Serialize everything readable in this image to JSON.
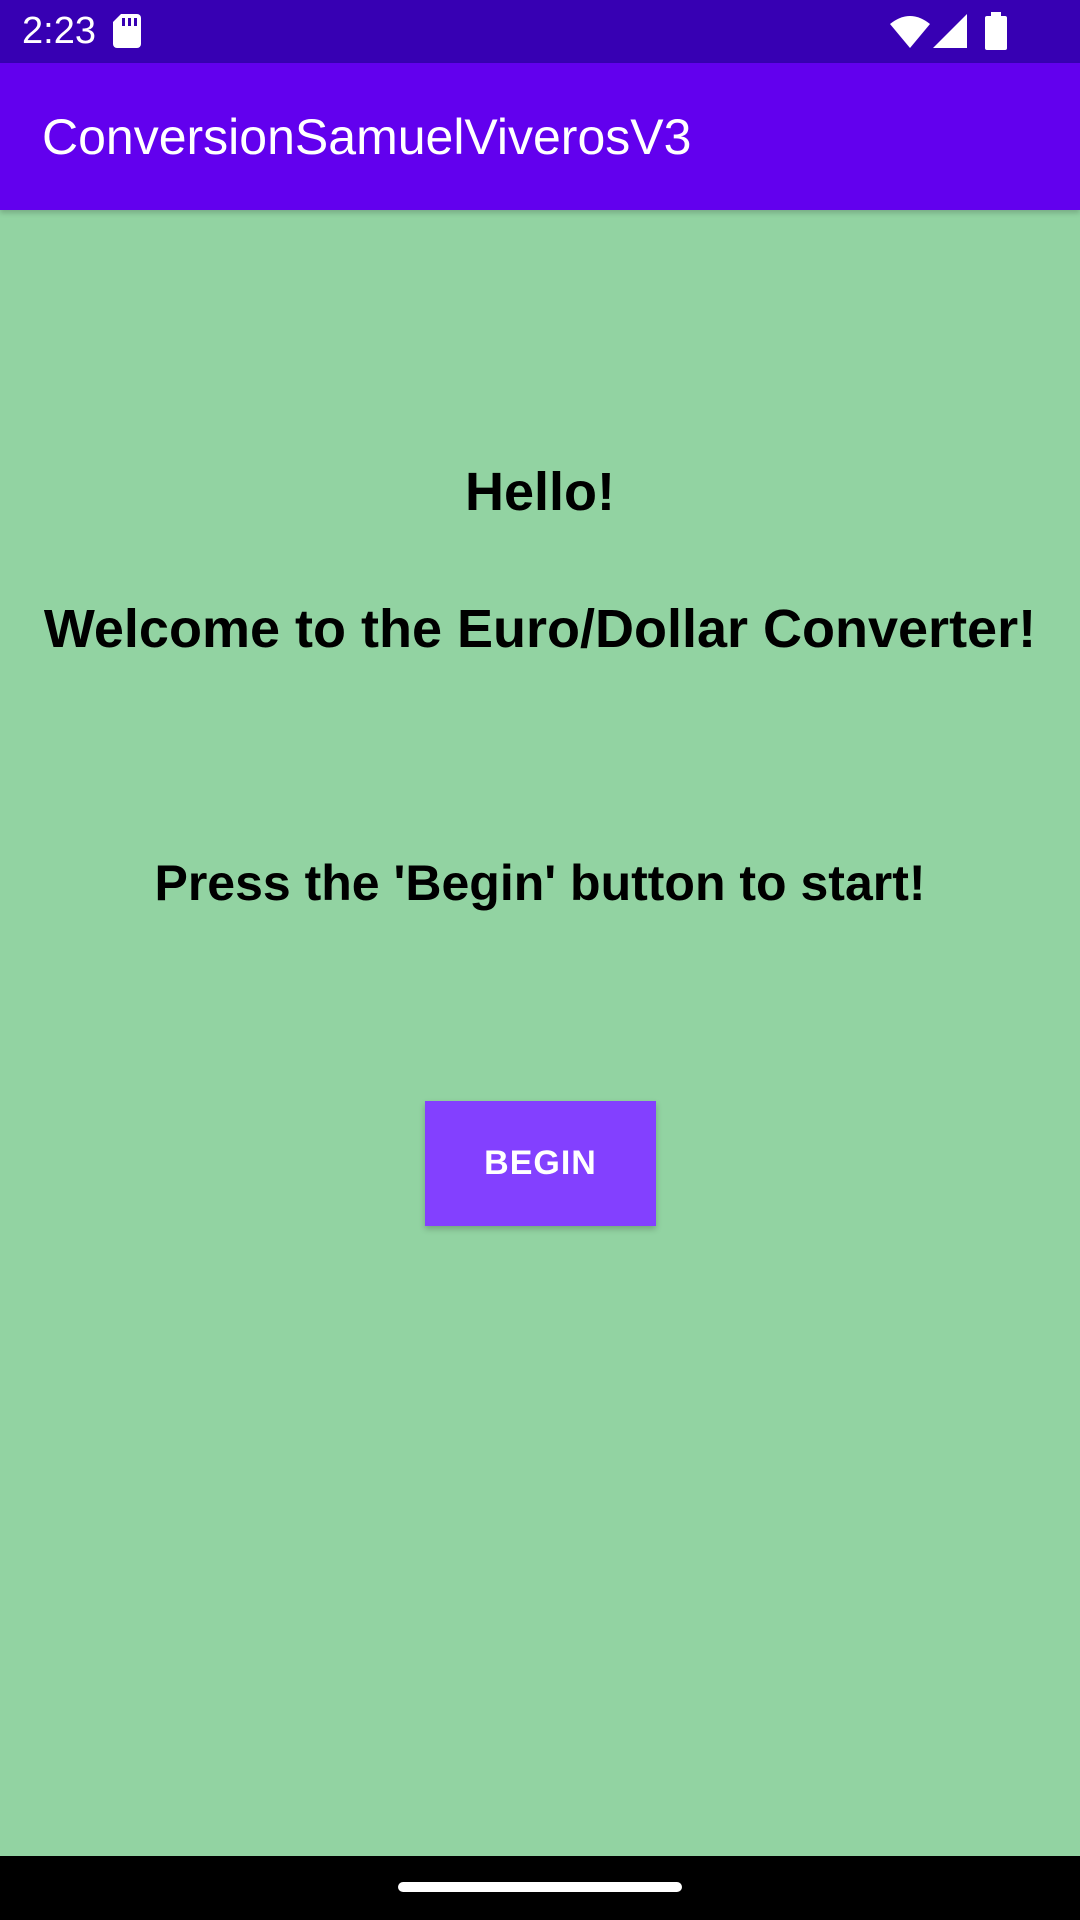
{
  "status_bar": {
    "time": "2:23",
    "icons": [
      "sd-card-icon",
      "wifi-icon",
      "signal-icon",
      "battery-icon"
    ],
    "background": "#3700b3"
  },
  "app_bar": {
    "title": "ConversionSamuelViverosV3",
    "background": "#6200ee"
  },
  "main": {
    "background": "#92d3a2",
    "greeting": "Hello!",
    "welcome": "Welcome to the Euro/Dollar Converter!",
    "instruction": "Press the 'Begin' button to start!",
    "begin_button_label": "BEGIN",
    "button_color": "#8340ff"
  },
  "nav_bar": {
    "icons": [
      "home-handle"
    ]
  }
}
